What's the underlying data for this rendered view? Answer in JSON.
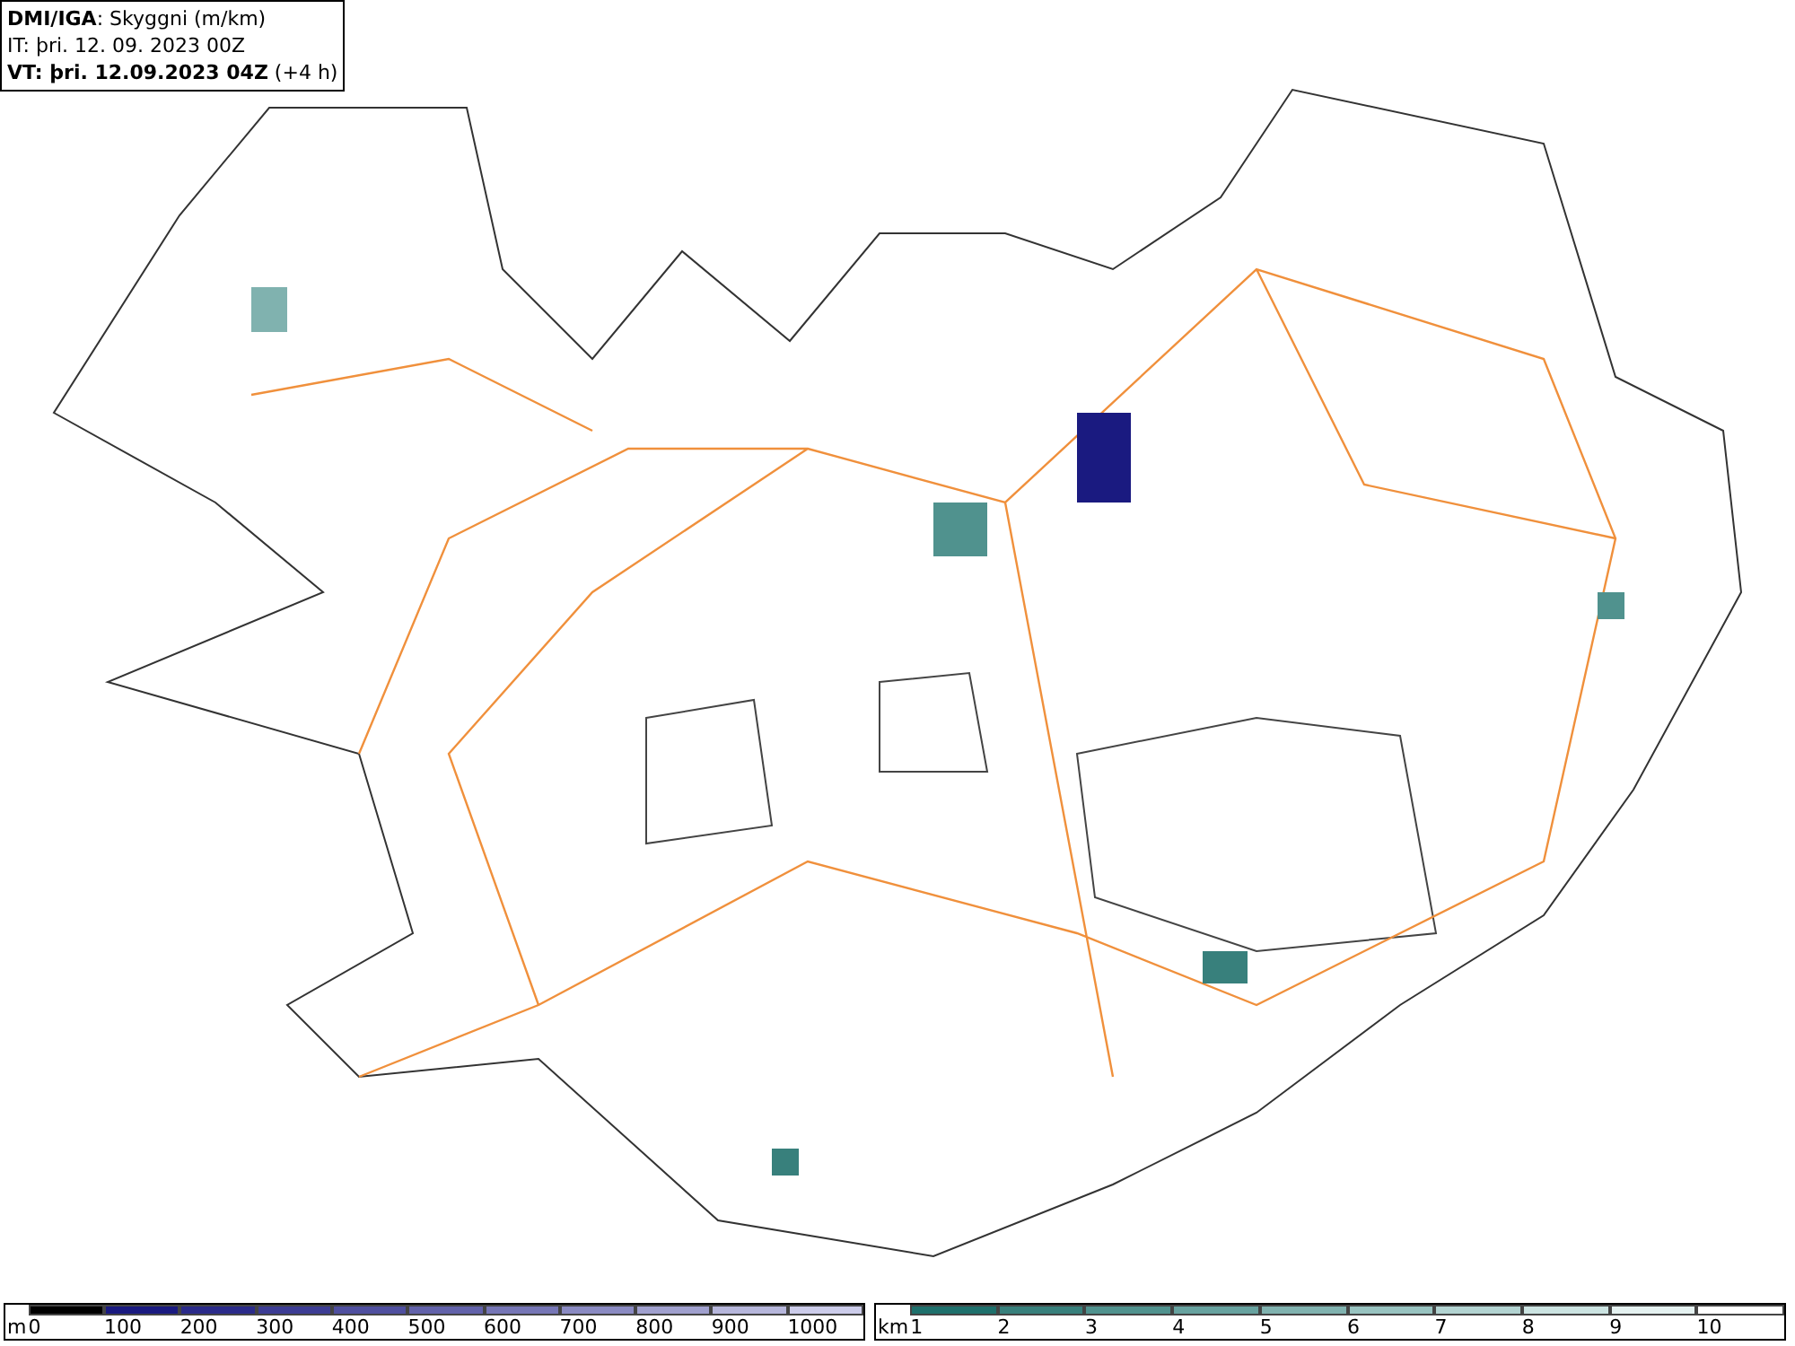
{
  "header": {
    "lines": [
      "**DMI/IGA**: Skyggni (m/km)",
      "IT: þri. 12. 09. 2023 00Z",
      "**VT: þri. 12.09.2023 04Z** (+4 h)"
    ]
  },
  "legends": [
    {
      "unit": "m",
      "steps": [
        {
          "label": "0",
          "color": "#000000"
        },
        {
          "label": "100",
          "color": "#1a1a80"
        },
        {
          "label": "200",
          "color": "#2b2b8a"
        },
        {
          "label": "300",
          "color": "#3c3c94"
        },
        {
          "label": "400",
          "color": "#4f4f9f"
        },
        {
          "label": "500",
          "color": "#6262aa"
        },
        {
          "label": "600",
          "color": "#7676b6"
        },
        {
          "label": "700",
          "color": "#8a8ac2"
        },
        {
          "label": "800",
          "color": "#a0a0ce"
        },
        {
          "label": "900",
          "color": "#b6b6db"
        },
        {
          "label": "1000",
          "color": "#ccccea"
        }
      ]
    },
    {
      "unit": "km",
      "steps": [
        {
          "label": "1",
          "color": "#1e706c"
        },
        {
          "label": "2",
          "color": "#38807c"
        },
        {
          "label": "3",
          "color": "#50928e"
        },
        {
          "label": "4",
          "color": "#67a29f"
        },
        {
          "label": "5",
          "color": "#80b2af"
        },
        {
          "label": "6",
          "color": "#98c3c0"
        },
        {
          "label": "7",
          "color": "#b2d3d1"
        },
        {
          "label": "8",
          "color": "#cbe3e1"
        },
        {
          "label": "9",
          "color": "#e4f1f0"
        },
        {
          "label": "10",
          "color": "#ffffff"
        }
      ]
    }
  ]
}
